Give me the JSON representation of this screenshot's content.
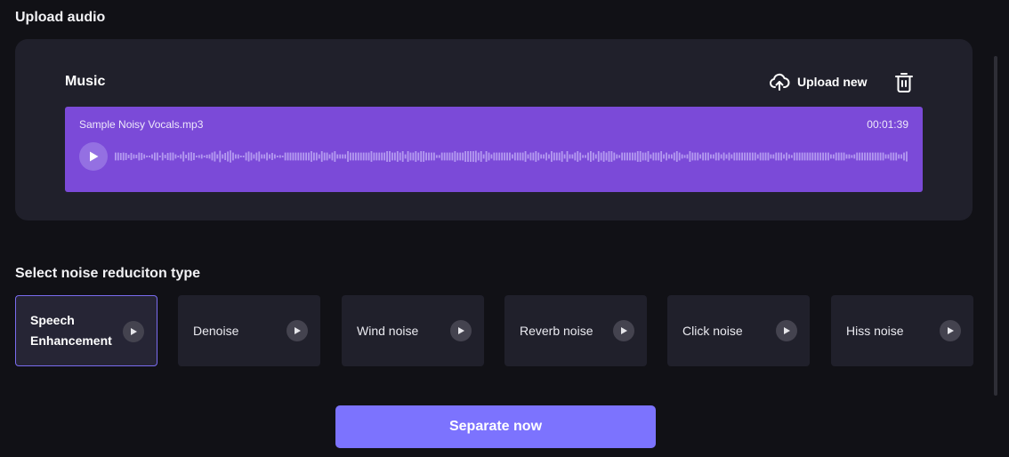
{
  "upload_section": {
    "title": "Upload audio",
    "panel_label": "Music",
    "upload_new_label": "Upload new",
    "icons": {
      "upload": "cloud-upload-icon",
      "delete": "trash-icon"
    },
    "track": {
      "file_name": "Sample Noisy Vocals.mp3",
      "duration": "00:01:39",
      "play_icon": "play-icon",
      "waveform_amplitudes": [
        0.55,
        0.55,
        0.5,
        0.55,
        0.5,
        0.25,
        0.5,
        0.3,
        0.25,
        0.55,
        0.5,
        0.3,
        0.1,
        0.1,
        0.3,
        0.55,
        0.55,
        0.1,
        0.55,
        0.25,
        0.5,
        0.55,
        0.55,
        0.3,
        0.1,
        0.3,
        0.7,
        0.25,
        0.55,
        0.6,
        0.5,
        0.1,
        0.2,
        0.3,
        0.1,
        0.25,
        0.3,
        0.55,
        0.7,
        0.3,
        0.8,
        0.3,
        0.5,
        0.7,
        0.85,
        0.55,
        0.3,
        0.3,
        0.1,
        0.1,
        0.55,
        0.7,
        0.55,
        0.3,
        0.55,
        0.7,
        0.3,
        0.3,
        0.55,
        0.3,
        0.5,
        0.3,
        0.1,
        0.2,
        0.1,
        0.55,
        0.55,
        0.55,
        0.55,
        0.55,
        0.55,
        0.55,
        0.55,
        0.55,
        0.55,
        0.75,
        0.55,
        0.55,
        0.3,
        0.75,
        0.55,
        0.55,
        0.3,
        0.55,
        0.75,
        0.3,
        0.3,
        0.3,
        0.3,
        0.75,
        0.55,
        0.55,
        0.55,
        0.55,
        0.55,
        0.55,
        0.55,
        0.55,
        0.75,
        0.55,
        0.55,
        0.55,
        0.55,
        0.55,
        0.75,
        0.75,
        0.55,
        0.55,
        0.75,
        0.55,
        0.75,
        0.3,
        0.75,
        0.55,
        0.55,
        0.75,
        0.55,
        0.75,
        0.75,
        0.55,
        0.55,
        0.55,
        0.55,
        0.2,
        0.2,
        0.55,
        0.55,
        0.55,
        0.55,
        0.55,
        0.75,
        0.55,
        0.55,
        0.55,
        0.75,
        0.75,
        0.75,
        0.75,
        0.8,
        0.55,
        0.75,
        0.3,
        0.75,
        0.55,
        0.3,
        0.55,
        0.55,
        0.55,
        0.55,
        0.55,
        0.55,
        0.55,
        0.3,
        0.55,
        0.55,
        0.55,
        0.55,
        0.75,
        0.3,
        0.55,
        0.55,
        0.75,
        0.55,
        0.3,
        0.3,
        0.55,
        0.3,
        0.75,
        0.55,
        0.55,
        0.55,
        0.75,
        0.3,
        0.75,
        0.3,
        0.3,
        0.55,
        0.75,
        0.55,
        0.2,
        0.2,
        0.55,
        0.75,
        0.55,
        0.3,
        0.75,
        0.55,
        0.75,
        0.55,
        0.75,
        0.75,
        0.55,
        0.3,
        0.2,
        0.55,
        0.55,
        0.55,
        0.55,
        0.55,
        0.55,
        0.75,
        0.75,
        0.55,
        0.55,
        0.75,
        0.3,
        0.55,
        0.55,
        0.55,
        0.75,
        0.3,
        0.55,
        0.3,
        0.3,
        0.55,
        0.75,
        0.55,
        0.3,
        0.2,
        0.3,
        0.75,
        0.55,
        0.55,
        0.55,
        0.3,
        0.55,
        0.55,
        0.55,
        0.3,
        0.3,
        0.55,
        0.55,
        0.3,
        0.55,
        0.3,
        0.55,
        0.3,
        0.55,
        0.55,
        0.55,
        0.55,
        0.55,
        0.55,
        0.55,
        0.55,
        0.55,
        0.3,
        0.55,
        0.55,
        0.55,
        0.55,
        0.3,
        0.3,
        0.55,
        0.55,
        0.55,
        0.3,
        0.55,
        0.3,
        0.2,
        0.55,
        0.55,
        0.55,
        0.55,
        0.55,
        0.55,
        0.55,
        0.55,
        0.55,
        0.55,
        0.55,
        0.55,
        0.55,
        0.55,
        0.3,
        0.3,
        0.55,
        0.55,
        0.55,
        0.55,
        0.3,
        0.3,
        0.2,
        0.3,
        0.55,
        0.55,
        0.55,
        0.55,
        0.55,
        0.55,
        0.55,
        0.55,
        0.55,
        0.55,
        0.55,
        0.3,
        0.3,
        0.55,
        0.55,
        0.55,
        0.3,
        0.3,
        0.55,
        0.7
      ]
    }
  },
  "noise_section": {
    "title": "Select noise reduciton type",
    "selected_index": 0,
    "options": [
      {
        "label": "Speech Enhancement",
        "selected": true
      },
      {
        "label": "Denoise",
        "selected": false
      },
      {
        "label": "Wind noise",
        "selected": false
      },
      {
        "label": "Reverb noise",
        "selected": false
      },
      {
        "label": "Click noise",
        "selected": false
      },
      {
        "label": "Hiss noise",
        "selected": false
      }
    ]
  },
  "actions": {
    "separate_label": "Separate now"
  },
  "colors": {
    "background": "#111116",
    "panel": "#20202b",
    "track": "#7b4ad8",
    "accent": "#7c73fe",
    "selected_border": "#7a6cf0"
  }
}
